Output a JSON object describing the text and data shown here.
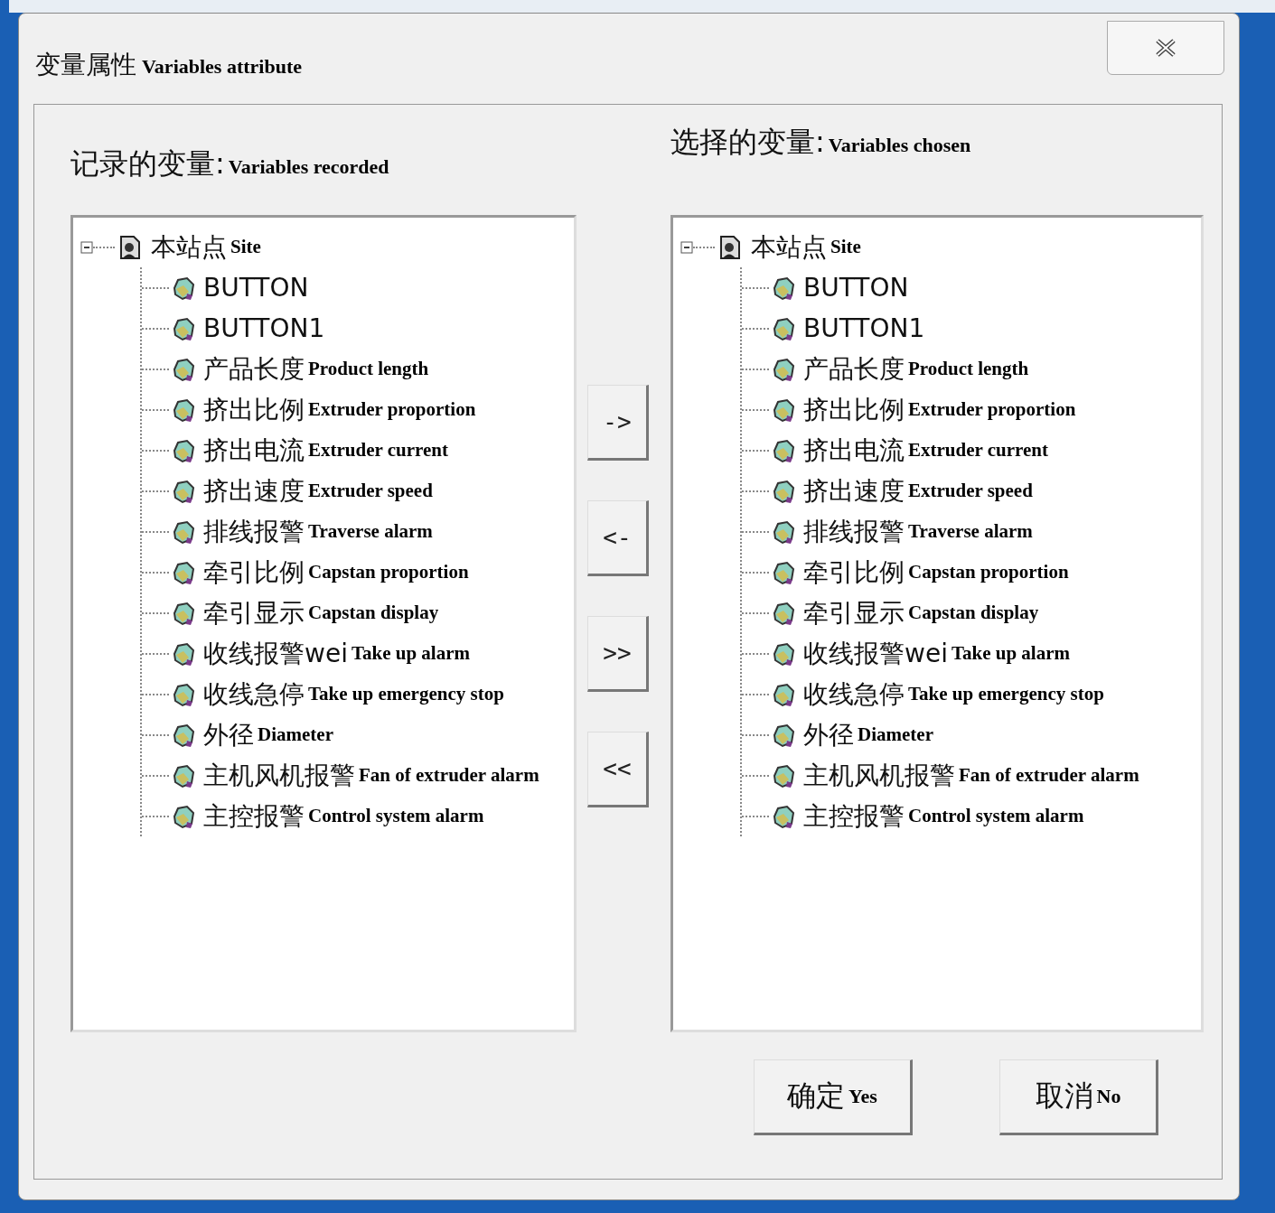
{
  "window": {
    "title": "变量属性",
    "title_translation": "Variables attribute"
  },
  "panels": [
    {
      "heading": "记录的变量:",
      "heading_translation": "Variables recorded",
      "tree": {
        "label": "本站点",
        "translation": "Site",
        "expanded": true,
        "children": [
          {
            "label": "BUTTON"
          },
          {
            "label": "BUTTON1"
          },
          {
            "label": "产品长度",
            "translation": "Product length"
          },
          {
            "label": "挤出比例",
            "translation": "Extruder proportion"
          },
          {
            "label": "挤出电流",
            "translation": "Extruder current"
          },
          {
            "label": "挤出速度",
            "translation": "Extruder speed"
          },
          {
            "label": "排线报警",
            "translation": "Traverse alarm"
          },
          {
            "label": "牵引比例",
            "translation": "Capstan proportion"
          },
          {
            "label": "牵引显示",
            "translation": "Capstan display"
          },
          {
            "label": "收线报警wei",
            "translation": "Take up alarm"
          },
          {
            "label": "收线急停",
            "translation": "Take up emergency stop"
          },
          {
            "label": "外径",
            "translation": "Diameter"
          },
          {
            "label": "主机风机报警",
            "translation": "Fan of extruder alarm"
          },
          {
            "label": "主控报警",
            "translation": "Control system alarm"
          }
        ]
      }
    },
    {
      "heading": "选择的变量:",
      "heading_translation": "Variables chosen",
      "tree": {
        "label": "本站点",
        "translation": "Site",
        "expanded": true,
        "children": [
          {
            "label": "BUTTON"
          },
          {
            "label": "BUTTON1"
          },
          {
            "label": "产品长度",
            "translation": "Product length"
          },
          {
            "label": "挤出比例",
            "translation": "Extruder proportion"
          },
          {
            "label": "挤出电流",
            "translation": "Extruder current"
          },
          {
            "label": "挤出速度",
            "translation": "Extruder speed"
          },
          {
            "label": "排线报警",
            "translation": "Traverse alarm"
          },
          {
            "label": "牵引比例",
            "translation": "Capstan proportion"
          },
          {
            "label": "牵引显示",
            "translation": "Capstan display"
          },
          {
            "label": "收线报警wei",
            "translation": "Take up alarm"
          },
          {
            "label": "收线急停",
            "translation": "Take up emergency stop"
          },
          {
            "label": "外径",
            "translation": "Diameter"
          },
          {
            "label": "主机风机报警",
            "translation": "Fan of extruder alarm"
          },
          {
            "label": "主控报警",
            "translation": "Control system alarm"
          }
        ]
      }
    }
  ],
  "move_buttons": [
    "->",
    "<-",
    ">>",
    "<<"
  ],
  "buttons": [
    {
      "label": "确定",
      "translation": "Yes"
    },
    {
      "label": "取消",
      "translation": "No"
    }
  ]
}
